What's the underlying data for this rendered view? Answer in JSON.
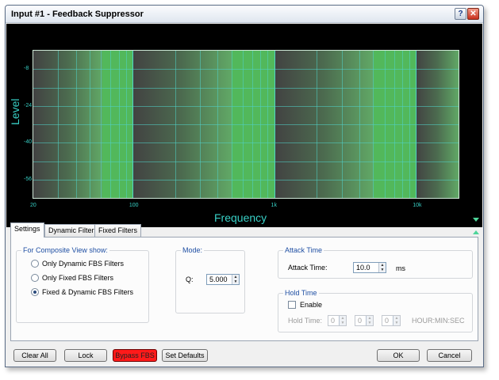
{
  "window": {
    "title": "Input #1 - Feedback Suppressor",
    "help_label": "?",
    "close_label": "✕"
  },
  "graph": {
    "y_title": "Level",
    "x_title": "Frequency",
    "y_labels": [
      "-8",
      "-24",
      "-40",
      "-56"
    ],
    "x_labels": [
      "20",
      "100",
      "1k",
      "10k"
    ],
    "expand_icon": "triangle-down",
    "collapse_icon": "triangle-up"
  },
  "chart_data": {
    "type": "area",
    "title": "",
    "xlabel": "Frequency",
    "ylabel": "Level",
    "x_scale": "log",
    "xlim": [
      20,
      20000
    ],
    "ylim": [
      -64,
      0
    ],
    "x_ticks": [
      "20",
      "100",
      "1k",
      "10k"
    ],
    "y_ticks": [
      "-8",
      "-24",
      "-40",
      "-56"
    ],
    "grid": true,
    "colors": {
      "background": "#000000",
      "band": "#52b85b",
      "grid": "#4fd6c6",
      "labels": "#38d0c6"
    }
  },
  "tabs": [
    {
      "label": "Settings",
      "active": true
    },
    {
      "label": "Dynamic Filters",
      "active": false
    },
    {
      "label": "Fixed Filters",
      "active": false
    }
  ],
  "settings": {
    "composite": {
      "title": "For Composite View show:",
      "options": [
        "Only Dynamic FBS Filters",
        "Only Fixed FBS Filters",
        "Fixed & Dynamic FBS Filters"
      ],
      "selected": "Fixed & Dynamic FBS Filters"
    },
    "mode": {
      "title": "Mode:",
      "q_label": "Q:",
      "q_value": "5.000"
    },
    "attack": {
      "title": "Attack Time",
      "label": "Attack Time:",
      "value": "10.0",
      "unit": "ms"
    },
    "hold": {
      "title": "Hold Time",
      "enable_label": "Enable",
      "enabled": false,
      "label": "Hold Time:",
      "hours": "0",
      "minutes": "0",
      "seconds": "0",
      "format": "HOUR:MIN:SEC"
    }
  },
  "buttons": {
    "clear_all": "Clear All",
    "lock": "Lock",
    "bypass": "Bypass FBS",
    "set_defaults": "Set Defaults",
    "ok": "OK",
    "cancel": "Cancel"
  },
  "colors": {
    "bypass_active": "#ff1a1a",
    "accent": "#1f4fa3"
  }
}
